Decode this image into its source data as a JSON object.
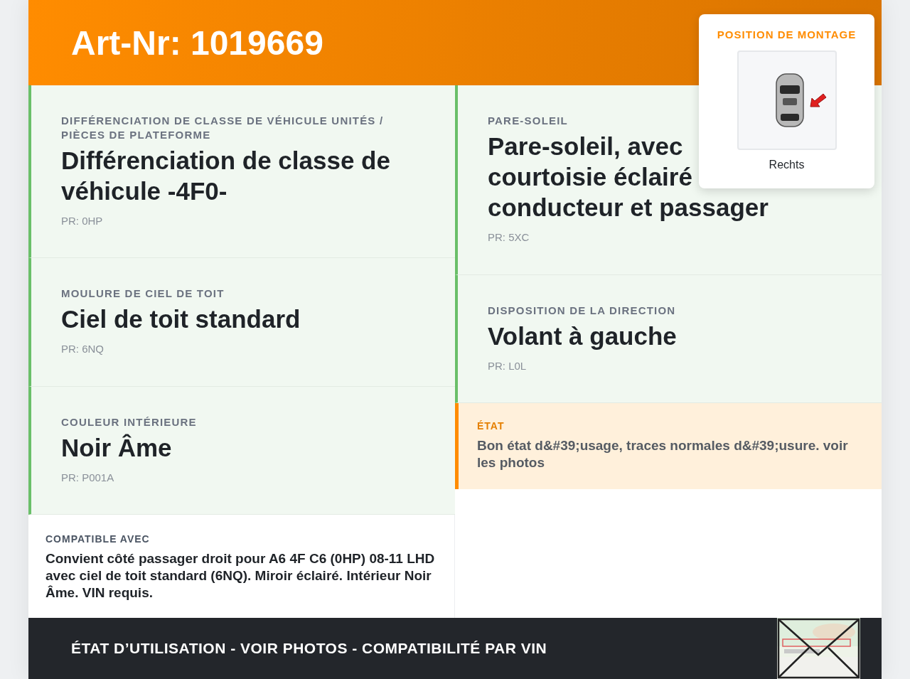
{
  "header": {
    "title": "Art-Nr: 1019669"
  },
  "mounting": {
    "label": "POSITION DE MONTAGE",
    "side": "Rechts"
  },
  "left": [
    {
      "category": "DIFFÉRENCIATION DE CLASSE DE VÉHICULE UNITÉS / PIÈCES DE PLATEFORME",
      "title": "Différenciation de classe de véhicule -4F0-",
      "pr": "PR: 0HP"
    },
    {
      "category": "MOULURE DE CIEL DE TOIT",
      "title": "Ciel de toit standard",
      "pr": "PR: 6NQ"
    },
    {
      "category": "COULEUR INTÉRIEURE",
      "title": "Noir Âme",
      "pr": "PR: P001A"
    }
  ],
  "compatible": {
    "label": "COMPATIBLE AVEC",
    "text": "Convient côté passager droit pour A6 4F C6 (0HP) 08-11 LHD avec ciel de toit standard (6NQ). Miroir éclairé. Intérieur Noir Âme. VIN requis."
  },
  "right": [
    {
      "category": "PARE-SOLEIL",
      "title_lines": [
        "Pare-soleil, avec",
        "courtoisie éclairé",
        "conducteur et passager"
      ],
      "pr": "PR: 5XC"
    },
    {
      "category": "DISPOSITION DE LA DIRECTION",
      "title": "Volant à gauche",
      "pr": "PR: L0L"
    }
  ],
  "condition": {
    "label": "ÉTAT",
    "text": "Bon état d&#39;usage, traces normales d&#39;usure. voir les photos"
  },
  "footer": {
    "text": "ÉTAT D’UTILISATION - VOIR PHOTOS - COMPATIBILITÉ PAR VIN"
  }
}
